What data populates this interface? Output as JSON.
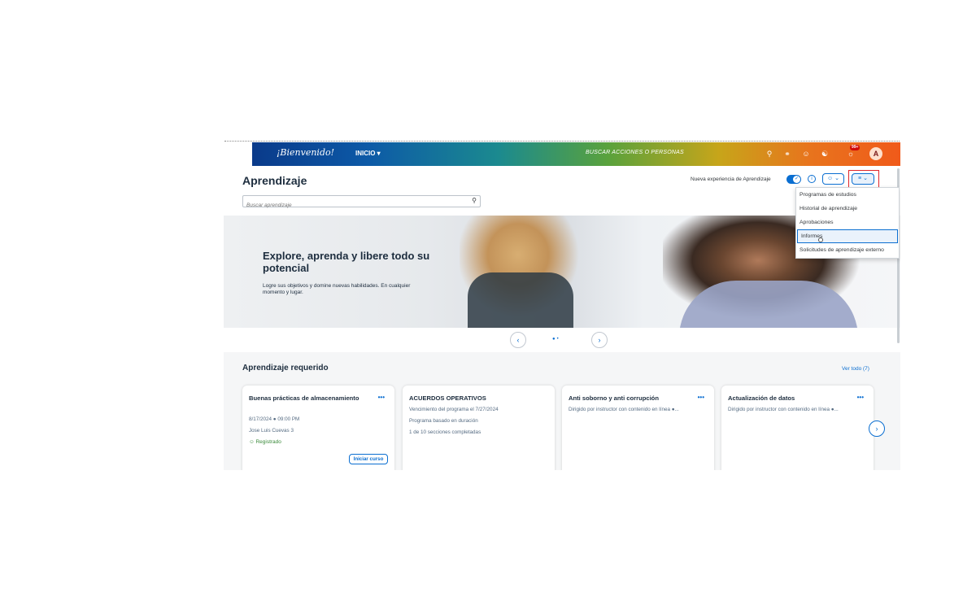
{
  "shell": {
    "logo": "¡Bienvenido!",
    "home_menu": "INICIO ▾",
    "search_label": "BUSCAR ACCIONES O PERSONAS",
    "notification_badge": "99+",
    "avatar_initial": "A",
    "icons": [
      "search-icon",
      "approvals-icon",
      "people-icon",
      "help-icon",
      "notifications-icon"
    ]
  },
  "page": {
    "title": "Aprendizaje",
    "search_placeholder": "Buscar aprendizaje",
    "new_experience_label": "Nueva experiencia de Aprendizaje"
  },
  "menu": {
    "items": [
      {
        "label": "Programas de estudios"
      },
      {
        "label": "Historial de aprendizaje"
      },
      {
        "label": "Aprobaciones"
      },
      {
        "label": "Informes",
        "active": true
      },
      {
        "label": "Solicitudes de aprendizaje externo"
      }
    ]
  },
  "banner": {
    "title": "Explore, aprenda y libere todo su potencial",
    "subtitle": "Logre sus objetivos y domine nuevas habilidades. En cualquier momento y lugar."
  },
  "required": {
    "title": "Aprendizaje requerido",
    "view_all": "Ver todo (7)",
    "cards": [
      {
        "title": "Buenas prácticas de almacenamiento",
        "lines": [
          "8/17/2024 ● 09:00 PM",
          "Jose Luis Cuevas 3"
        ],
        "status": "Registrado",
        "action": "Iniciar curso"
      },
      {
        "title": "ACUERDOS OPERATIVOS",
        "lines": [
          "Vencimiento del programa el 7/27/2024",
          "Programa basado en duración",
          "1 de 10 secciones completadas"
        ]
      },
      {
        "title": "Anti soborno y anti corrupción",
        "lines": [
          "Dirigido por instructor con contenido en línea ●..."
        ]
      },
      {
        "title": "Actualización de datos",
        "lines": [
          "Dirigido por instructor con contenido en línea ●..."
        ]
      }
    ]
  }
}
